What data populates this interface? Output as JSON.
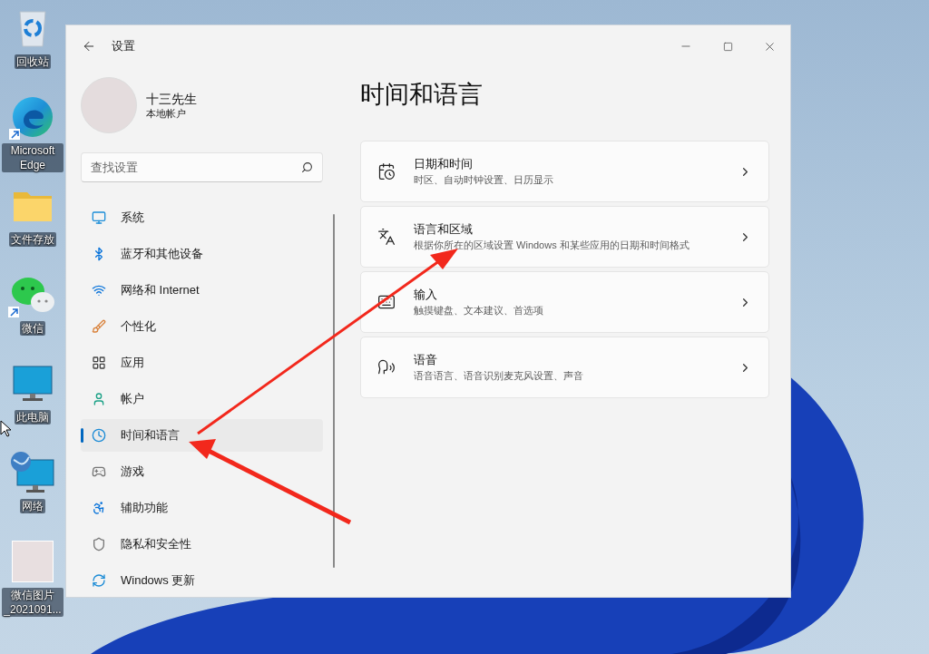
{
  "desktop_icons": [
    {
      "label": "回收站",
      "kind": "recycle",
      "shortcut": false
    },
    {
      "label": "Microsoft Edge",
      "kind": "edge",
      "shortcut": true
    },
    {
      "label": "文件存放",
      "kind": "folder",
      "shortcut": false
    },
    {
      "label": "微信",
      "kind": "wechat",
      "shortcut": true
    },
    {
      "label": "此电脑",
      "kind": "pc",
      "shortcut": false
    },
    {
      "label": "网络",
      "kind": "network",
      "shortcut": false
    },
    {
      "label": "微信图片_2021091...",
      "kind": "photo",
      "shortcut": false
    }
  ],
  "window": {
    "title": "设置"
  },
  "profile": {
    "name": "十三先生",
    "account_type": "本地帐户"
  },
  "search": {
    "placeholder": "查找设置"
  },
  "sidebar": {
    "items": [
      {
        "label": "系统",
        "kind": "system",
        "selected": false
      },
      {
        "label": "蓝牙和其他设备",
        "kind": "bluetooth",
        "selected": false
      },
      {
        "label": "网络和 Internet",
        "kind": "network",
        "selected": false
      },
      {
        "label": "个性化",
        "kind": "personalize",
        "selected": false
      },
      {
        "label": "应用",
        "kind": "apps",
        "selected": false
      },
      {
        "label": "帐户",
        "kind": "accounts",
        "selected": false
      },
      {
        "label": "时间和语言",
        "kind": "time",
        "selected": true
      },
      {
        "label": "游戏",
        "kind": "gaming",
        "selected": false
      },
      {
        "label": "辅助功能",
        "kind": "accessibility",
        "selected": false
      },
      {
        "label": "隐私和安全性",
        "kind": "privacy",
        "selected": false
      },
      {
        "label": "Windows 更新",
        "kind": "update",
        "selected": false
      }
    ]
  },
  "page": {
    "title": "时间和语言",
    "cards": [
      {
        "title": "日期和时间",
        "description": "时区、自动时钟设置、日历显示",
        "kind": "datetime"
      },
      {
        "title": "语言和区域",
        "description": "根据你所在的区域设置 Windows 和某些应用的日期和时间格式",
        "kind": "language"
      },
      {
        "title": "输入",
        "description": "触摸键盘、文本建议、首选项",
        "kind": "typing"
      },
      {
        "title": "语音",
        "description": "语音语言、语音识别麦克风设置、声音",
        "kind": "speech"
      }
    ]
  }
}
